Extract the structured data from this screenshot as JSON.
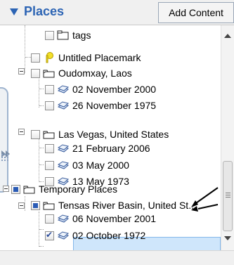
{
  "header": {
    "title": "Places",
    "add_content_label": "Add Content",
    "accent": "#2c64b4"
  },
  "tree": {
    "items": [
      {
        "label": "tags",
        "icon": "folder-icon",
        "checked": false
      },
      {
        "label": "Untitled Placemark",
        "icon": "placemark-pin-icon",
        "checked": false
      },
      {
        "label": "Oudomxay, Laos",
        "icon": "open-folder-icon",
        "checked": false
      },
      {
        "label": "02 November 2000",
        "icon": "imagery-layer-icon",
        "checked": false
      },
      {
        "label": "26 November 1975",
        "icon": "imagery-layer-icon",
        "checked": false
      },
      {
        "label": "Las Vegas, United States",
        "icon": "open-folder-icon",
        "checked": false
      },
      {
        "label": "21 February 2006",
        "icon": "imagery-layer-icon",
        "checked": false
      },
      {
        "label": "03 May 2000",
        "icon": "imagery-layer-icon",
        "checked": false
      },
      {
        "label": "13 May 1973",
        "icon": "imagery-layer-icon",
        "checked": false
      },
      {
        "label": "Temporary Places",
        "icon": "open-folder-icon",
        "checked": "partial"
      },
      {
        "label": "Tensas River Basin, United St...",
        "icon": "open-folder-icon",
        "checked": "partial"
      },
      {
        "label": "06 November 2001",
        "icon": "imagery-layer-icon",
        "checked": false,
        "selected": true
      },
      {
        "label": "02 October 1972",
        "icon": "imagery-layer-icon",
        "checked": true
      }
    ]
  },
  "colors": {
    "selection": "#cfe6fb",
    "check": "#2a4b9a"
  }
}
